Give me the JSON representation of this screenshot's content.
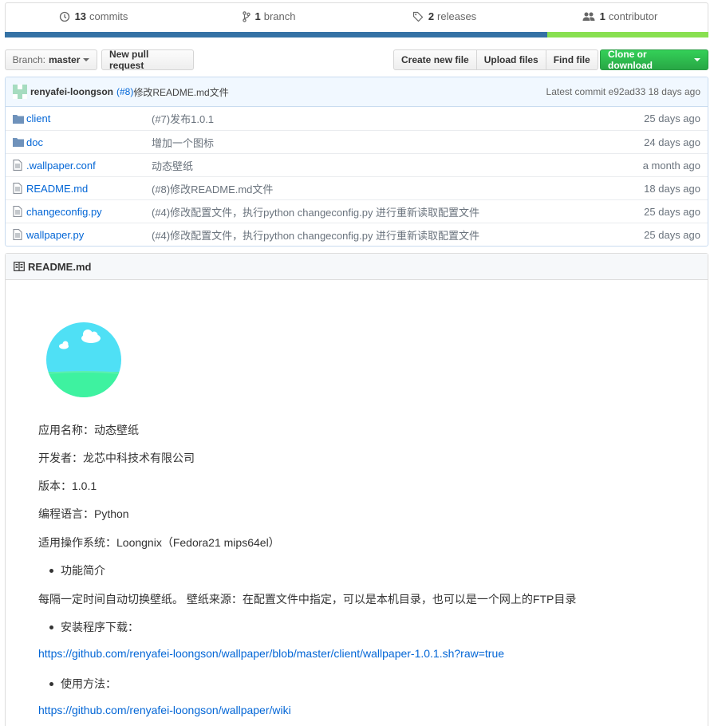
{
  "stats": {
    "commits_count": "13",
    "commits_label": "commits",
    "branches_count": "1",
    "branches_label": "branch",
    "releases_count": "2",
    "releases_label": "releases",
    "contributors_count": "1",
    "contributors_label": "contributor"
  },
  "language_colors": {
    "python": "#3572A5",
    "shell": "#89e051"
  },
  "toolbar": {
    "branch_prefix": "Branch:",
    "branch_name": "master",
    "new_pull_request": "New pull request",
    "create_new_file": "Create new file",
    "upload_files": "Upload files",
    "find_file": "Find file",
    "clone_or_download": "Clone or download"
  },
  "commit": {
    "author": "renyafei-loongson",
    "number": "(#8)",
    "message": "修改README.md文件",
    "latest": "Latest commit e92ad33 18 days ago"
  },
  "files": [
    {
      "name": "client",
      "type": "folder",
      "message": "(#7)发布1.0.1",
      "age": "25 days ago"
    },
    {
      "name": "doc",
      "type": "folder",
      "message": "增加一个图标",
      "age": "24 days ago"
    },
    {
      "name": ".wallpaper.conf",
      "type": "file",
      "message": "动态壁纸",
      "age": "a month ago"
    },
    {
      "name": "README.md",
      "type": "file",
      "message": "(#8)修改README.md文件",
      "age": "18 days ago"
    },
    {
      "name": "changeconfig.py",
      "type": "file",
      "message": "(#4)修改配置文件，执行python changeconfig.py 进行重新读取配置文件",
      "age": "25 days ago"
    },
    {
      "name": "wallpaper.py",
      "type": "file",
      "message": "(#4)修改配置文件，执行python changeconfig.py 进行重新读取配置文件",
      "age": "25 days ago"
    }
  ],
  "readme": {
    "header": "README.md",
    "app_name": "应用名称：动态壁纸",
    "developer": "开发者：龙芯中科技术有限公司",
    "version": "版本：1.0.1",
    "language": "编程语言：Python",
    "os": "适用操作系统：Loongnix（Fedora21 mips64el）",
    "bullet_intro": "功能简介",
    "intro_text": "每隔一定时间自动切换壁纸。 壁纸来源：在配置文件中指定，可以是本机目录，也可以是一个网上的FTP目录",
    "bullet_download": "安装程序下载：",
    "download_link": "https://github.com/renyafei-loongson/wallpaper/blob/master/client/wallpaper-1.0.1.sh?raw=true",
    "bullet_usage": "使用方法：",
    "usage_link": "https://github.com/renyafei-loongson/wallpaper/wiki"
  }
}
